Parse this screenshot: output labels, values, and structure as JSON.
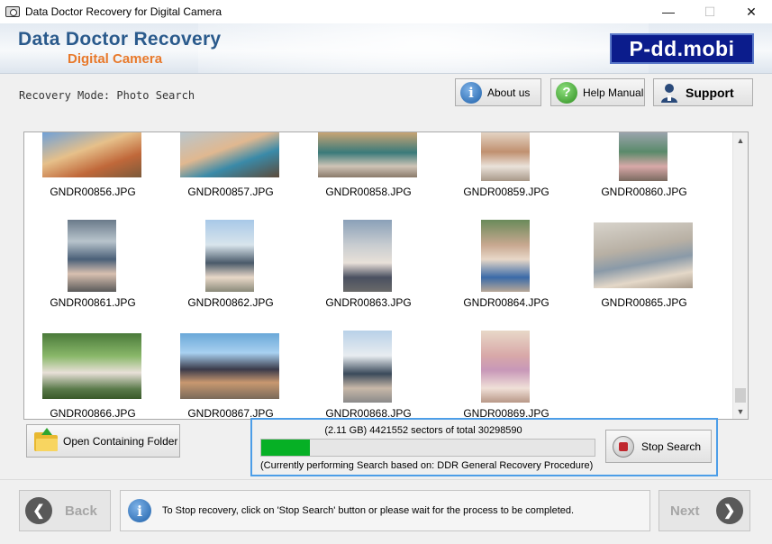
{
  "window": {
    "title": "Data Doctor Recovery for Digital Camera",
    "minimize": "—",
    "maximize": "☐",
    "close": "✕"
  },
  "header": {
    "brand_line1": "Data Doctor Recovery",
    "brand_line2": "Digital Camera",
    "logo": "P-dd.mobi"
  },
  "mode": {
    "label": "Recovery Mode: Photo Search"
  },
  "toolbar": {
    "about_label": "About us",
    "help_label": "Help Manual",
    "support_label": "Support"
  },
  "gallery": {
    "files": [
      "GNDR00856.JPG",
      "GNDR00857.JPG",
      "GNDR00858.JPG",
      "GNDR00859.JPG",
      "GNDR00860.JPG",
      "GNDR00861.JPG",
      "GNDR00862.JPG",
      "GNDR00863.JPG",
      "GNDR00864.JPG",
      "GNDR00865.JPG",
      "GNDR00866.JPG",
      "GNDR00867.JPG",
      "GNDR00868.JPG",
      "GNDR00869.JPG"
    ]
  },
  "folder_button": {
    "label": "Open Containing Folder"
  },
  "progress": {
    "sectors_text": "(2.11 GB) 4421552  sectors  of  total 30298590",
    "fraction": 0.1459,
    "note": "(Currently performing Search based on:  DDR General Recovery Procedure)",
    "stop_label": "Stop Search"
  },
  "footer": {
    "back_label": "Back",
    "next_label": "Next",
    "info_text": "To Stop recovery, click on 'Stop Search' button or please wait for the process to be completed."
  },
  "colors": {
    "brand_blue": "#2a5a8c",
    "brand_orange": "#e8792b",
    "progress_green": "#06b025",
    "highlight_border": "#4d9ee8"
  }
}
